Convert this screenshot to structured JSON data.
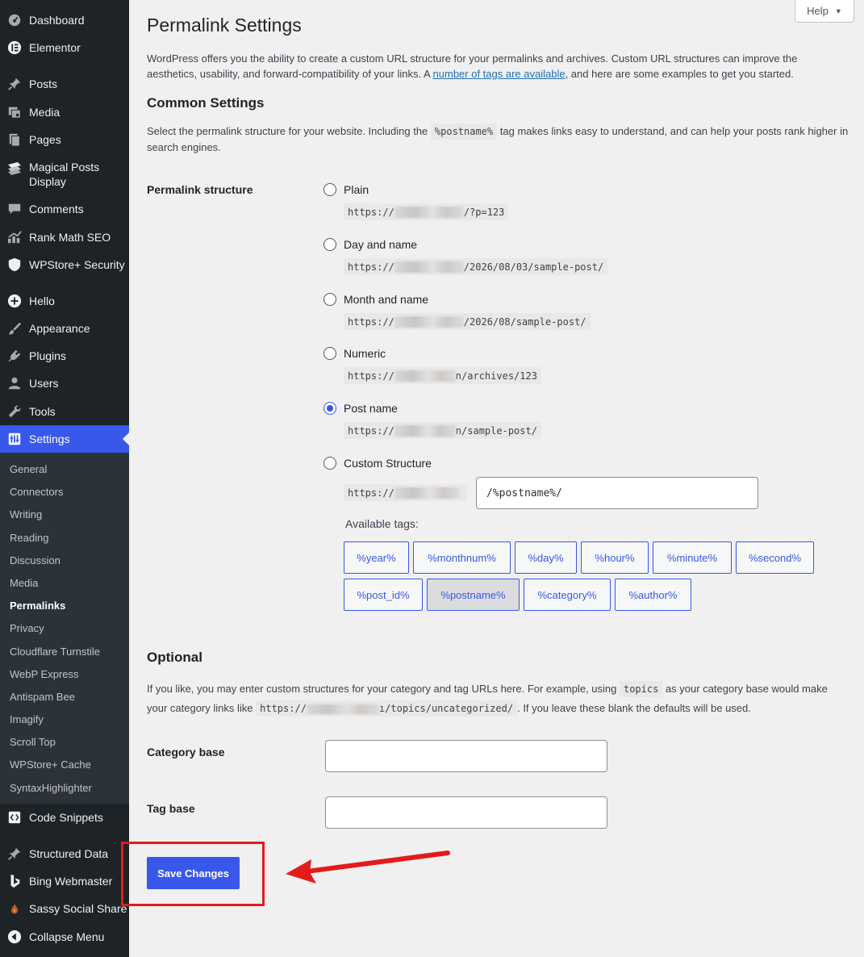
{
  "sidebar": {
    "items": [
      {
        "label": "Dashboard",
        "icon": "dashboard-icon"
      },
      {
        "label": "Elementor",
        "icon": "elementor-icon"
      },
      {
        "label": "Posts",
        "icon": "pin-icon"
      },
      {
        "label": "Media",
        "icon": "media-icon"
      },
      {
        "label": "Pages",
        "icon": "pages-icon"
      },
      {
        "label": "Magical Posts Display",
        "icon": "plugin-icon"
      },
      {
        "label": "Comments",
        "icon": "comments-icon"
      },
      {
        "label": "Rank Math SEO",
        "icon": "chart-icon"
      },
      {
        "label": "WPStore+ Security",
        "icon": "shield-icon"
      },
      {
        "label": "Hello",
        "icon": "plus-circle-icon"
      },
      {
        "label": "Appearance",
        "icon": "brush-icon"
      },
      {
        "label": "Plugins",
        "icon": "plug-icon"
      },
      {
        "label": "Users",
        "icon": "user-icon"
      },
      {
        "label": "Tools",
        "icon": "wrench-icon"
      },
      {
        "label": "Settings",
        "icon": "settings-icon"
      },
      {
        "label": "Code Snippets",
        "icon": "code-icon"
      },
      {
        "label": "Structured Data",
        "icon": "pin-icon"
      },
      {
        "label": "Bing Webmaster",
        "icon": "bing-icon"
      },
      {
        "label": "Sassy Social Share",
        "icon": "share-icon"
      },
      {
        "label": "Collapse Menu",
        "icon": "collapse-icon"
      }
    ],
    "submenu": [
      "General",
      "Connectors",
      "Writing",
      "Reading",
      "Discussion",
      "Media",
      "Permalinks",
      "Privacy",
      "Cloudflare Turnstile",
      "WebP Express",
      "Antispam Bee",
      "Imagify",
      "Scroll Top",
      "WPStore+ Cache",
      "SyntaxHighlighter"
    ]
  },
  "help": {
    "label": "Help"
  },
  "page": {
    "title": "Permalink Settings",
    "intro_pre": "WordPress offers you the ability to create a custom URL structure for your permalinks and archives. Custom URL structures can improve the aesthetics, usability, and forward-compatibility of your links. A ",
    "intro_link": "number of tags are available",
    "intro_post": ", and here are some examples to get you started."
  },
  "common": {
    "heading": "Common Settings",
    "desc_pre": "Select the permalink structure for your website. Including the ",
    "desc_code": "%postname%",
    "desc_post": " tag makes links easy to understand, and can help your posts rank higher in search engines.",
    "field_label": "Permalink structure",
    "options": [
      {
        "label": "Plain",
        "prefix": "https://",
        "suffix": "/?p=123",
        "checked": false
      },
      {
        "label": "Day and name",
        "prefix": "https://",
        "suffix": "/2026/08/03/sample-post/",
        "checked": false
      },
      {
        "label": "Month and name",
        "prefix": "https://",
        "suffix": "/2026/08/sample-post/",
        "checked": false
      },
      {
        "label": "Numeric",
        "prefix": "https://",
        "suffix": "n/archives/123",
        "checked": false
      },
      {
        "label": "Post name",
        "prefix": "https://",
        "suffix": "n/sample-post/",
        "checked": true
      },
      {
        "label": "Custom Structure",
        "prefix": "https://",
        "suffix": "",
        "checked": false
      }
    ],
    "custom_value": "/%postname%/",
    "available_tags_label": "Available tags:",
    "tags": [
      "%year%",
      "%monthnum%",
      "%day%",
      "%hour%",
      "%minute%",
      "%second%",
      "%post_id%",
      "%postname%",
      "%category%",
      "%author%"
    ],
    "active_tag": "%postname%"
  },
  "optional": {
    "heading": "Optional",
    "desc_pre": "If you like, you may enter custom structures for your category and tag URLs here. For example, using ",
    "desc_code1": "topics",
    "desc_mid": " as your category base would make your category links like ",
    "desc_code2_prefix": "https://",
    "desc_code2_suffix": "ı/topics/uncategorized/",
    "desc_post": ". If you leave these blank the defaults will be used.",
    "category_label": "Category base",
    "category_value": "",
    "tag_label": "Tag base",
    "tag_value": ""
  },
  "save": {
    "label": "Save Changes"
  },
  "colors": {
    "accent": "#3858e9",
    "sidebar": "#1d2327",
    "annotation": "#e31b1b"
  }
}
